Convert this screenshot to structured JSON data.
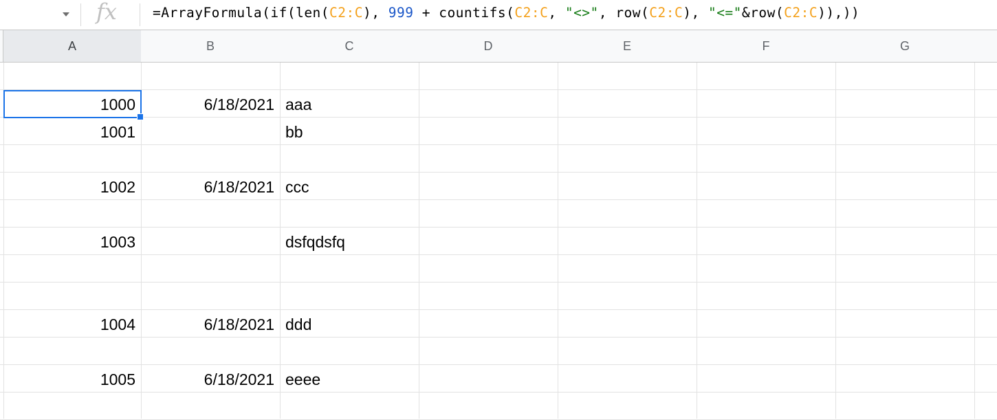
{
  "formula_bar": {
    "fx_label": "fx",
    "tokens": [
      {
        "text": "=ArrayFormula(if(len(",
        "kind": "plain"
      },
      {
        "text": "C2:C",
        "kind": "ref"
      },
      {
        "text": "), ",
        "kind": "plain"
      },
      {
        "text": "999",
        "kind": "num"
      },
      {
        "text": " + countifs(",
        "kind": "plain"
      },
      {
        "text": "C2:C",
        "kind": "ref"
      },
      {
        "text": ", ",
        "kind": "plain"
      },
      {
        "text": "\"<>\"",
        "kind": "str"
      },
      {
        "text": ", row(",
        "kind": "plain"
      },
      {
        "text": "C2:C",
        "kind": "ref"
      },
      {
        "text": "), ",
        "kind": "plain"
      },
      {
        "text": "\"<=\"",
        "kind": "str"
      },
      {
        "text": "&row(",
        "kind": "plain"
      },
      {
        "text": "C2:C",
        "kind": "ref"
      },
      {
        "text": ")),))",
        "kind": "plain"
      }
    ]
  },
  "columns": [
    "A",
    "B",
    "C",
    "D",
    "E",
    "F",
    "G"
  ],
  "selected_column": "A",
  "rows": [
    {
      "a": "",
      "b": "",
      "c": ""
    },
    {
      "a": "1000",
      "b": "6/18/2021",
      "c": "aaa"
    },
    {
      "a": "1001",
      "b": "",
      "c": "bb"
    },
    {
      "a": "",
      "b": "",
      "c": ""
    },
    {
      "a": "1002",
      "b": "6/18/2021",
      "c": "ccc"
    },
    {
      "a": "",
      "b": "",
      "c": ""
    },
    {
      "a": "1003",
      "b": "",
      "c": "dsfqdsfq"
    },
    {
      "a": "",
      "b": "",
      "c": ""
    },
    {
      "a": "",
      "b": "",
      "c": ""
    },
    {
      "a": "1004",
      "b": "6/18/2021",
      "c": "ddd"
    },
    {
      "a": "",
      "b": "",
      "c": ""
    },
    {
      "a": "1005",
      "b": "6/18/2021",
      "c": "eeee"
    },
    {
      "a": "",
      "b": "",
      "c": ""
    }
  ],
  "colors": {
    "selection": "#1a73e8",
    "ref": "#f4a11c",
    "number": "#1a56c8",
    "string": "#137a13"
  }
}
